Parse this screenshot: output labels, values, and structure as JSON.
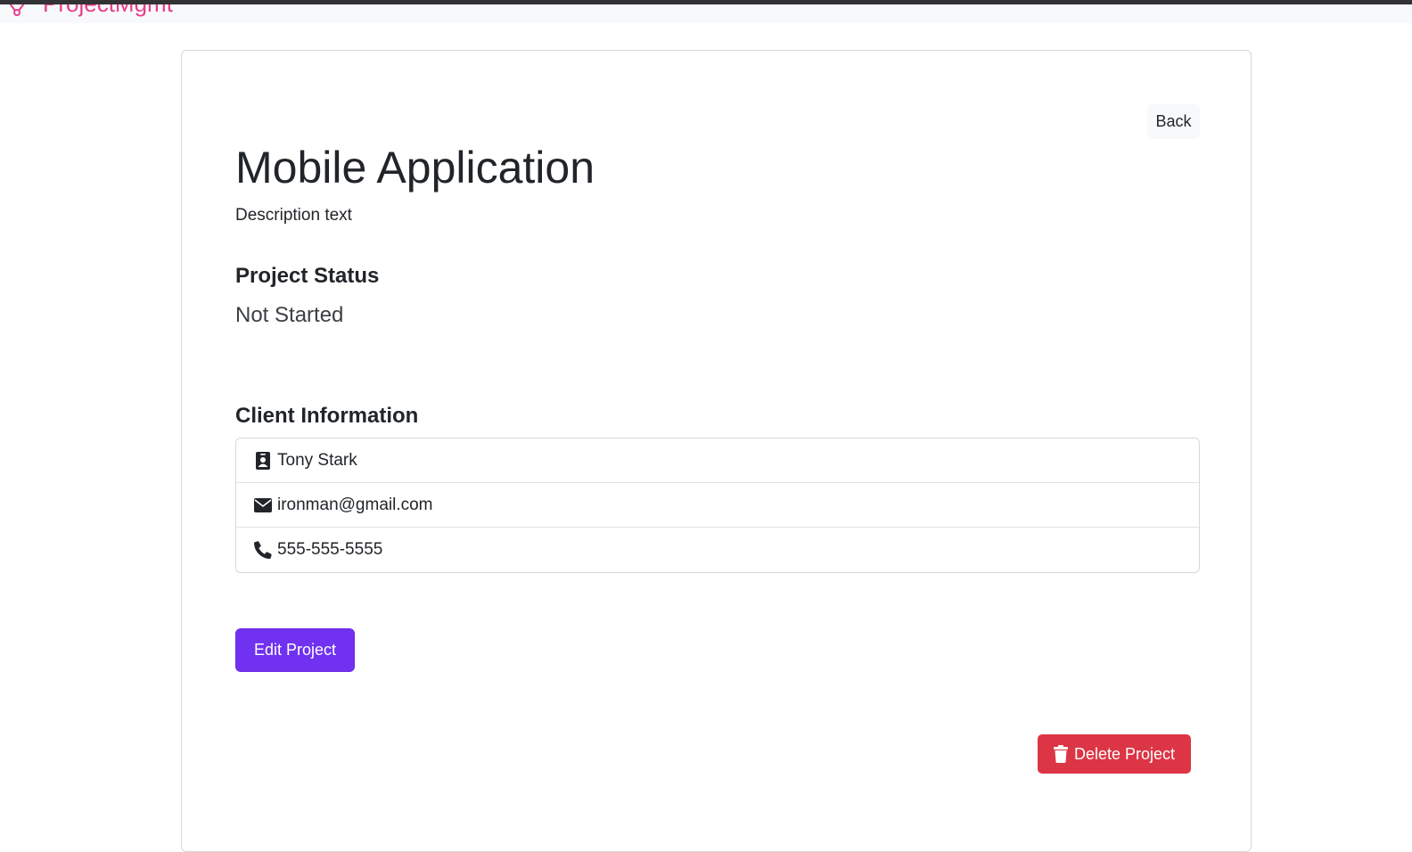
{
  "navbar": {
    "brand_text": "ProjectMgmt",
    "brand_color": "#e83e8c",
    "brand_icon": "network-icon"
  },
  "project": {
    "back_label": "Back",
    "title": "Mobile Application",
    "description": "Description text",
    "status_heading": "Project Status",
    "status_value": "Not Started"
  },
  "client": {
    "heading": "Client Information",
    "items": [
      {
        "icon": "contact-card-icon",
        "value": "Tony Stark"
      },
      {
        "icon": "envelope-icon",
        "value": "ironman@gmail.com"
      },
      {
        "icon": "phone-icon",
        "value": "555-555-5555"
      }
    ]
  },
  "actions": {
    "edit_label": "Edit Project",
    "edit_color": "#7032f0",
    "delete_label": "Delete Project",
    "delete_color": "#dc3545",
    "delete_icon": "trash-icon"
  }
}
